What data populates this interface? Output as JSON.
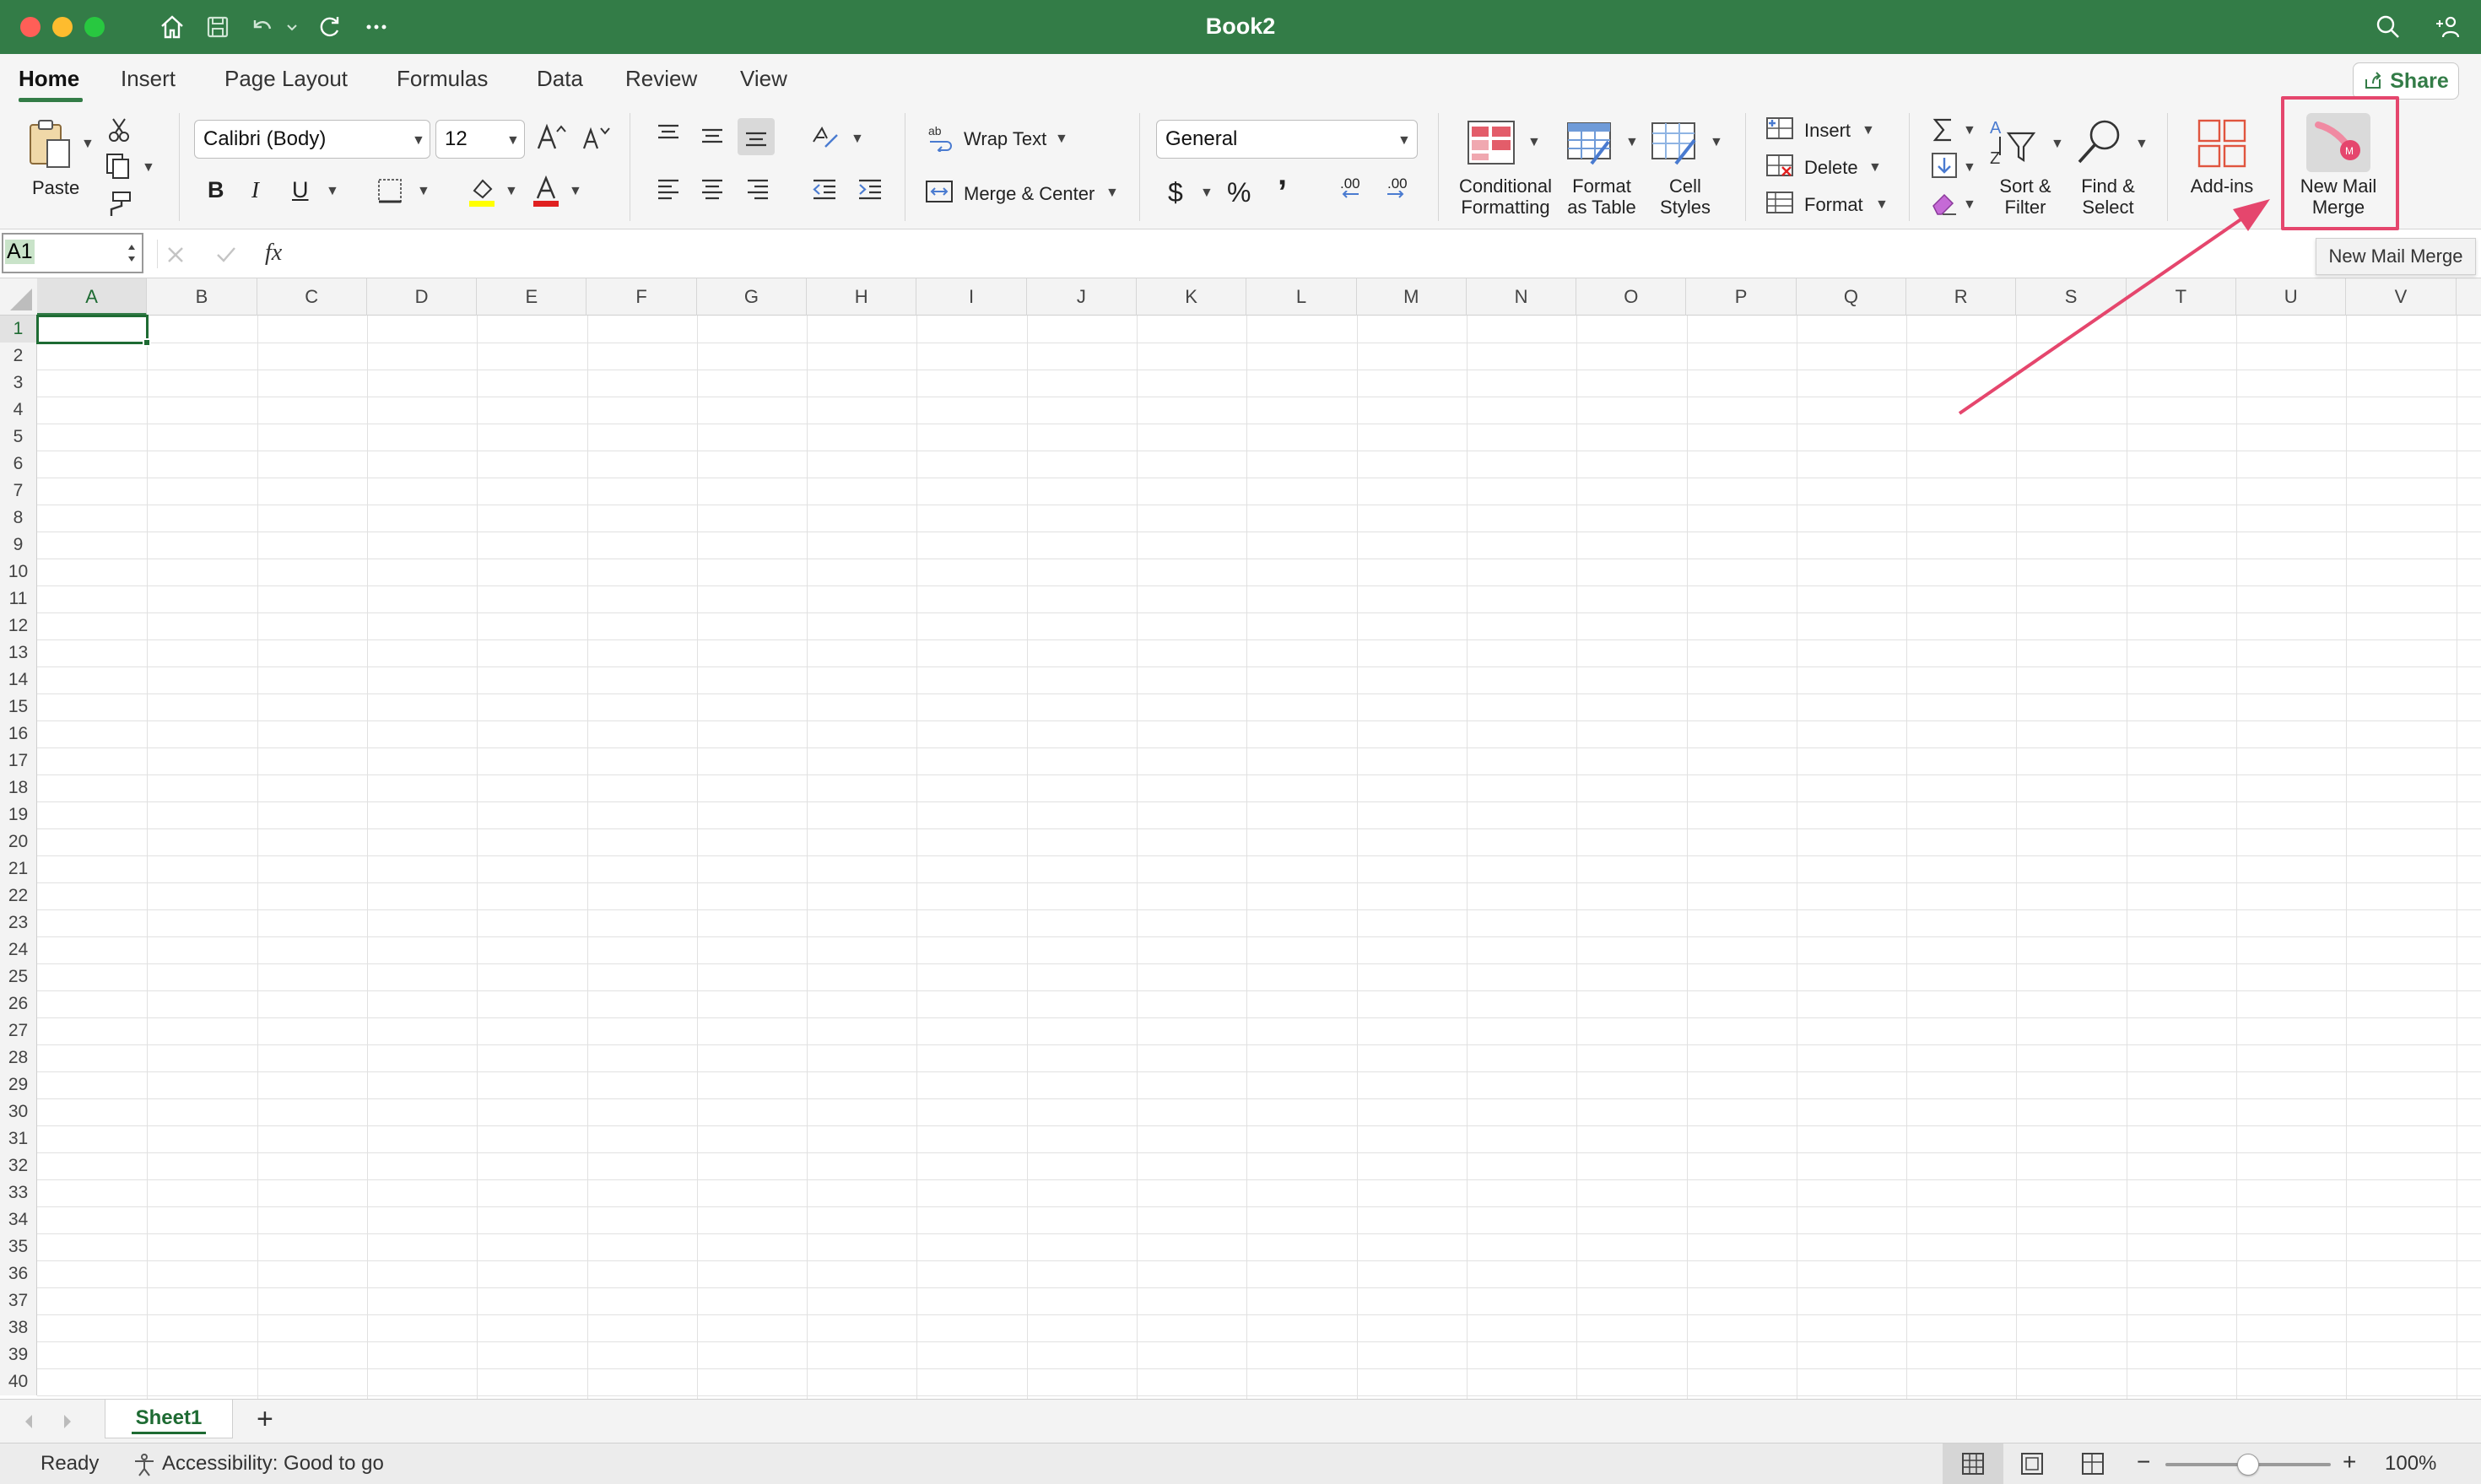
{
  "window": {
    "title": "Book2"
  },
  "tabs": [
    {
      "label": "Home",
      "active": true
    },
    {
      "label": "Insert"
    },
    {
      "label": "Page Layout"
    },
    {
      "label": "Formulas"
    },
    {
      "label": "Data"
    },
    {
      "label": "Review"
    },
    {
      "label": "View"
    }
  ],
  "share_label": "Share",
  "ribbon": {
    "paste": "Paste",
    "font_name": "Calibri (Body)",
    "font_size": "12",
    "bold": "B",
    "italic": "I",
    "underline": "U",
    "wrap_text": "Wrap Text",
    "merge_center": "Merge & Center",
    "number_format": "General",
    "currency": "$",
    "percent": "%",
    "comma": "’",
    "inc_decimal": ".00",
    "dec_decimal": ".00",
    "conditional_formatting": [
      "Conditional",
      "Formatting"
    ],
    "format_as_table": [
      "Format",
      "as Table"
    ],
    "cell_styles": [
      "Cell",
      "Styles"
    ],
    "insert": "Insert",
    "delete": "Delete",
    "format": "Format",
    "sort_filter": [
      "Sort &",
      "Filter"
    ],
    "find_select": [
      "Find &",
      "Select"
    ],
    "add_ins": "Add-ins",
    "new_mail_merge": [
      "New Mail",
      "Merge"
    ]
  },
  "formula_bar": {
    "name_box": "A1",
    "fx": "fx",
    "value": ""
  },
  "grid": {
    "columns": [
      "A",
      "B",
      "C",
      "D",
      "E",
      "F",
      "G",
      "H",
      "I",
      "J",
      "K",
      "L",
      "M",
      "N",
      "O",
      "P",
      "Q",
      "R",
      "S",
      "T",
      "U",
      "V"
    ],
    "rows": [
      "1",
      "2",
      "3",
      "4",
      "5",
      "6",
      "7",
      "8",
      "9",
      "10",
      "11",
      "12",
      "13",
      "14",
      "15",
      "16",
      "17",
      "18",
      "19",
      "20",
      "21",
      "22",
      "23",
      "24",
      "25",
      "26",
      "27",
      "28",
      "29",
      "30",
      "31",
      "32",
      "33",
      "34",
      "35",
      "36",
      "37",
      "38",
      "39",
      "40"
    ],
    "selected_cell": "A1"
  },
  "sheets": [
    {
      "name": "Sheet1",
      "active": true
    }
  ],
  "add_sheet": "+",
  "status": {
    "ready": "Ready",
    "accessibility": "Accessibility: Good to go",
    "zoom": "100%",
    "zoom_minus": "−",
    "zoom_plus": "+",
    "zoom_fraction": 0.5
  },
  "tooltip": "New Mail Merge",
  "colors": {
    "excel_green": "#337c47",
    "highlight": "#e5466d"
  }
}
